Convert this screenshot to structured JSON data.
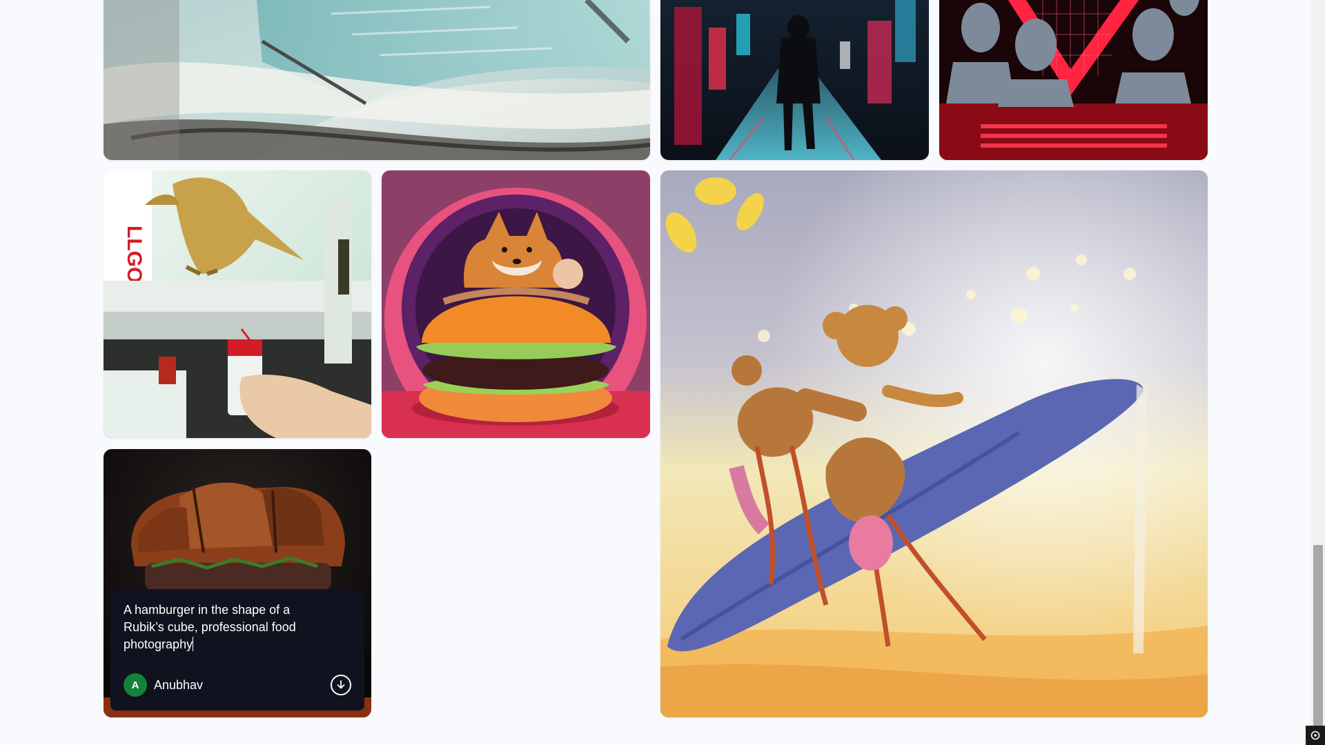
{
  "gallery": {
    "cards": [
      {
        "id": "escalator",
        "icon": "image"
      },
      {
        "id": "alley",
        "icon": "image"
      },
      {
        "id": "neon",
        "icon": "image"
      },
      {
        "id": "dino",
        "icon": "image"
      },
      {
        "id": "shiba",
        "icon": "image"
      },
      {
        "id": "mice",
        "icon": "image"
      },
      {
        "id": "burger",
        "icon": "image"
      }
    ],
    "hover_card": {
      "prompt": "A hamburger in the shape of a Rubik’s cube, professional food photography",
      "author_initial": "A",
      "author_name": "Anubhav",
      "download_icon": "download-icon",
      "avatar_color": "#14823a"
    }
  },
  "colors": {
    "page_background": "#f9fafe",
    "overlay_background": "#10131f"
  }
}
